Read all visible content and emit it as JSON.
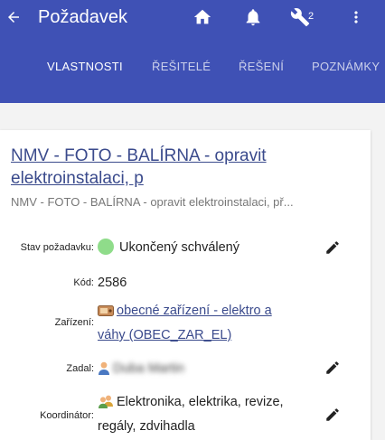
{
  "header": {
    "title": "Požadavek",
    "back_icon": "arrow-back-icon",
    "actions": {
      "home_icon": "home-icon",
      "notifications_icon": "bell-icon",
      "tools_icon": "wrench-icon",
      "tools_count": "2",
      "menu_icon": "more-vert-icon"
    },
    "color": "#3f51b5"
  },
  "tabs": [
    {
      "label": "VLASTNOSTI",
      "active": true
    },
    {
      "label": "ŘEŠITELÉ",
      "active": false
    },
    {
      "label": "ŘEŠENÍ",
      "active": false
    },
    {
      "label": "POZNÁMKY",
      "active": false
    }
  ],
  "request": {
    "title": "NMV - FOTO - BALÍRNA - opravit elektroinstalaci, p",
    "subtitle": "NMV - FOTO - BALÍRNA - opravit elektroinstalaci, př...",
    "fields": {
      "status": {
        "label": "Stav požadavku:",
        "value": "Ukončený schválený",
        "color": "#8fdc8a"
      },
      "code": {
        "label": "Kód:",
        "value": "2586"
      },
      "device": {
        "label": "Zařízení:",
        "value_line1": "obecné zařízení - elektro a",
        "value_line2": "váhy (OBEC_ZAR_EL)"
      },
      "submitter": {
        "label": "Zadal:",
        "value": "Duba Martin"
      },
      "coordinator": {
        "label": "Koordinátor:",
        "value_line1": "Elektronika, elektrika, revize,",
        "value_line2": "regály, zdvihadla"
      }
    }
  }
}
